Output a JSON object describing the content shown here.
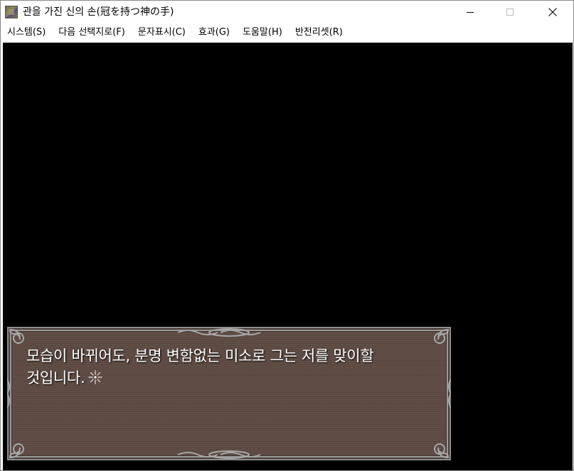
{
  "window": {
    "title": "관을 가진 신의 손(冠を持つ神の手)",
    "icon": "app-icon"
  },
  "menu": {
    "items": [
      {
        "label": "시스템(S)"
      },
      {
        "label": "다음 선택지로(F)"
      },
      {
        "label": "문자표시(C)"
      },
      {
        "label": "효과(G)"
      },
      {
        "label": "도움말(H)"
      },
      {
        "label": "반전리셋(R)"
      }
    ]
  },
  "message": {
    "line1": "모습이 바뀌어도, 분명 변함없는 미소로 그는 저를 맞이할",
    "line2": "것입니다.",
    "cursor_icon": "sparkle-icon"
  },
  "colors": {
    "game_background": "#000000",
    "message_box": "#5e4b43",
    "message_border": "#8d8d8d",
    "message_text": "#ffffff"
  }
}
